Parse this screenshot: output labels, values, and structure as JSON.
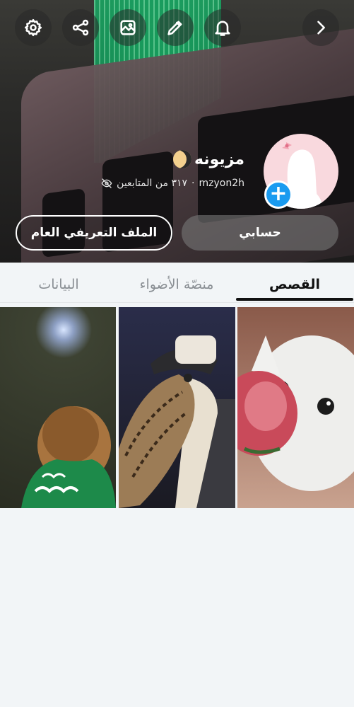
{
  "profile": {
    "display_name": "مزيونه",
    "username": "mzyon2h",
    "followers_text": "٣١٧ من المتابعين",
    "separator": "·"
  },
  "buttons": {
    "account": "حسابي",
    "public_profile": "الملف التعريفي العام"
  },
  "toolbar": {
    "icons": [
      "chevron-right-icon",
      "bell-icon",
      "pencil-icon",
      "image-icon",
      "share-icon",
      "gear-icon"
    ]
  },
  "tabs": [
    {
      "label": "القصص",
      "active": true
    },
    {
      "label": "منصّة الأضواء",
      "active": false
    },
    {
      "label": "البيانات",
      "active": false
    }
  ],
  "colors": {
    "accent_blue": "#1a9bf0",
    "avatar_bg": "#f9d9de"
  }
}
